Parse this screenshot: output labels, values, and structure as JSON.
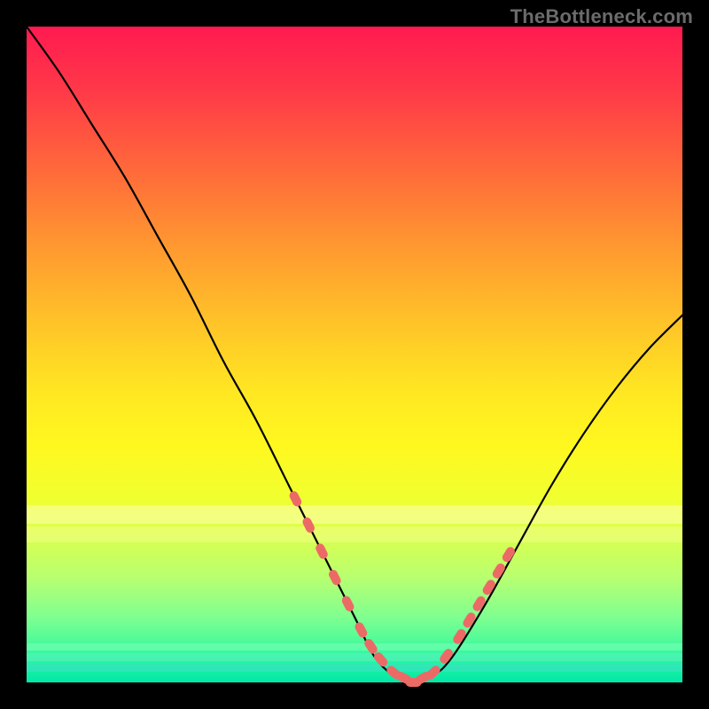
{
  "watermark": "TheBottleneck.com",
  "colors": {
    "frame": "#000000",
    "gradient_top": "#ff1a50",
    "gradient_bottom": "#00e8a8",
    "curve": "#000000",
    "marker": "#ec6a66"
  },
  "chart_data": {
    "type": "line",
    "title": "",
    "xlabel": "",
    "ylabel": "",
    "xlim": [
      0,
      100
    ],
    "ylim": [
      0,
      100
    ],
    "grid": false,
    "legend": false,
    "series": [
      {
        "name": "bottleneck-curve",
        "x": [
          0,
          5,
          10,
          15,
          20,
          25,
          30,
          35,
          40,
          45,
          50,
          53,
          56,
          59,
          62,
          65,
          70,
          75,
          80,
          85,
          90,
          95,
          100
        ],
        "y": [
          100,
          93,
          85,
          77,
          68,
          59,
          49,
          40,
          30,
          20,
          10,
          4,
          1,
          0,
          1,
          4,
          12,
          21,
          30,
          38,
          45,
          51,
          56
        ]
      }
    ],
    "markers": {
      "name": "highlighted-points",
      "x": [
        41,
        43,
        45,
        47,
        49,
        51,
        52.5,
        54,
        56,
        57.5,
        59,
        60.5,
        62,
        64,
        66,
        67.5,
        69,
        70.5,
        72,
        73.5
      ],
      "y": [
        28,
        24,
        20,
        16,
        12,
        8,
        5.5,
        3.5,
        1.5,
        0.7,
        0,
        0.7,
        1.5,
        4,
        7,
        9.5,
        12,
        14.5,
        17,
        19.5
      ]
    }
  }
}
